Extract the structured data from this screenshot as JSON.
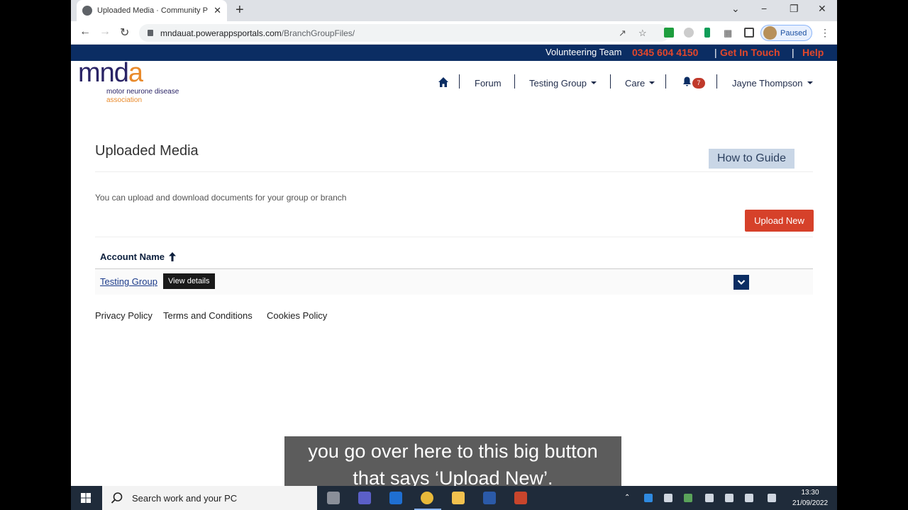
{
  "browser": {
    "tab_title": "Uploaded Media · Community P",
    "tab_close": "✕",
    "new_tab": "+",
    "url_host": "mndauat.powerappsportals.com",
    "url_path": "/BranchGroupFiles/",
    "profile_status": "Paused",
    "win_min": "−",
    "win_max": "❐",
    "win_close": "✕",
    "tab_list": "⌄"
  },
  "topbar": {
    "volunteering": "Volunteering Team",
    "phone": "0345 604 4150",
    "sep": "|",
    "get_in_touch": "Get In Touch",
    "help": "Help"
  },
  "logo": {
    "mark_left": "mnd",
    "mark_right": "a",
    "line1": "motor neurone disease",
    "line2": "association"
  },
  "nav": {
    "forum": "Forum",
    "testing_group": "Testing Group",
    "care": "Care",
    "notifications_count": "7",
    "user": "Jayne Thompson"
  },
  "content": {
    "title": "Uploaded Media",
    "guide_button": "How to Guide",
    "intro": "You can upload and download documents for your group or branch",
    "upload_button": "Upload New",
    "column_header": "Account Name",
    "rows": [
      {
        "account": "Testing Group",
        "tooltip": "View details"
      }
    ]
  },
  "footer": {
    "privacy": "Privacy Policy",
    "terms": "Terms and Conditions",
    "cookies": "Cookies Policy"
  },
  "caption": {
    "line1": "you go over here to this big button",
    "line2": "that says ‘Upload New’."
  },
  "taskbar": {
    "search_placeholder": "Search work and your PC",
    "time": "13:30",
    "date": "21/09/2022"
  },
  "colors": {
    "brand_navy": "#0b2d63",
    "accent_red": "#d6412a",
    "logo_orange": "#e98a2b"
  }
}
